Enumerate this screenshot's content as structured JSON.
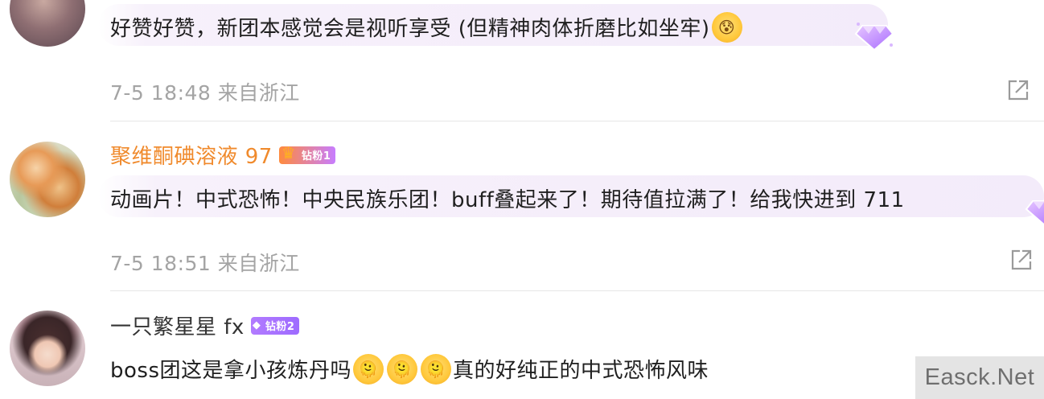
{
  "comments": [
    {
      "username": "",
      "content": "好赞好赞，新团本感觉会是视听享受 (但精神肉体折磨比如坐牢)",
      "content_emoji": "😰",
      "timestamp": "7-5 18:48",
      "location": "来自浙江"
    },
    {
      "username": "聚维酮碘溶液 97",
      "badge": "钻粉1",
      "content": "动画片！中式恐怖！中央民族乐团！buff叠起来了！期待值拉满了！给我快进到 711",
      "timestamp": "7-5 18:51",
      "location": "来自浙江"
    },
    {
      "username": "一只繁星星 fx",
      "badge": "钻粉2",
      "content_prefix": "boss团这是拿小孩炼丹吗",
      "content_emojis": [
        "🫠",
        "🫠",
        "🫠"
      ],
      "content_suffix": "真的好纯正的中式恐怖风味"
    }
  ],
  "icons": {
    "share": "share-icon",
    "gem": "diamond-gem-icon",
    "crown": "crown-icon"
  },
  "colors": {
    "username_gold": "#f08a2c",
    "meta_gray": "#a4a4a4",
    "bubble": "#f3ebfa",
    "badge_purple": "#9e6bff"
  },
  "watermark": "Easck.Net"
}
